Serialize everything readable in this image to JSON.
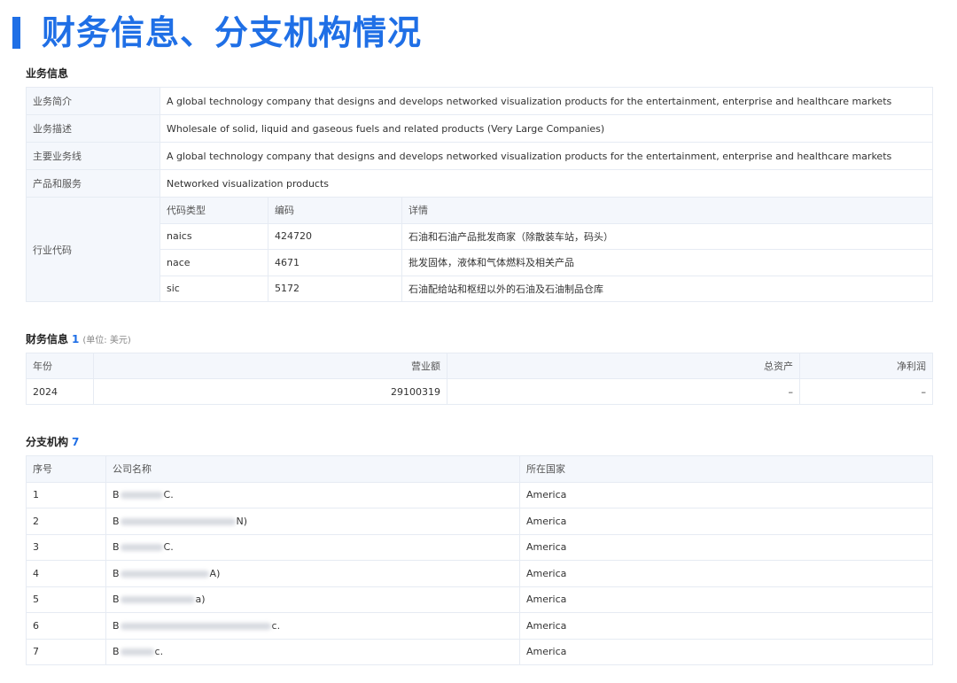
{
  "title": "财务信息、分支机构情况",
  "business": {
    "section_title": "业务信息",
    "rows": [
      {
        "label": "业务简介",
        "value": "A global technology company that designs and develops networked visualization products for the entertainment, enterprise and healthcare markets"
      },
      {
        "label": "业务描述",
        "value": "Wholesale of solid, liquid and gaseous fuels and related products (Very Large Companies)"
      },
      {
        "label": "主要业务线",
        "value": "A global technology company that designs and develops networked visualization products for the entertainment, enterprise and healthcare markets"
      },
      {
        "label": "产品和服务",
        "value": "Networked visualization products"
      }
    ],
    "industry": {
      "label": "行业代码",
      "headers": [
        "代码类型",
        "编码",
        "详情"
      ],
      "rows": [
        [
          "naics",
          "424720",
          "石油和石油产品批发商家（除散装车站，码头）"
        ],
        [
          "nace",
          "4671",
          "批发固体，液体和气体燃料及相关产品"
        ],
        [
          "sic",
          "5172",
          "石油配给站和枢纽以外的石油及石油制品仓库"
        ]
      ]
    }
  },
  "financial": {
    "section_title": "财务信息",
    "count": "1",
    "unit": "(单位: 美元)",
    "headers": [
      "年份",
      "营业额",
      "总资产",
      "净利润"
    ],
    "rows": [
      [
        "2024",
        "29100319",
        "–",
        "–"
      ]
    ]
  },
  "branches": {
    "section_title": "分支机构",
    "count": "7",
    "headers": [
      "序号",
      "公司名称",
      "所在国家"
    ],
    "rows": [
      {
        "no": "1",
        "prefix": "B",
        "suffix": "C.",
        "country": "America"
      },
      {
        "no": "2",
        "prefix": "B",
        "suffix": "N)",
        "country": "America"
      },
      {
        "no": "3",
        "prefix": "B",
        "suffix": "C.",
        "country": "America"
      },
      {
        "no": "4",
        "prefix": "B",
        "suffix": "A)",
        "country": "America"
      },
      {
        "no": "5",
        "prefix": "B",
        "suffix": "a)",
        "country": "America"
      },
      {
        "no": "6",
        "prefix": "B",
        "suffix": "c.",
        "country": "America"
      },
      {
        "no": "7",
        "prefix": "B",
        "suffix": "c.",
        "country": "America"
      }
    ]
  }
}
